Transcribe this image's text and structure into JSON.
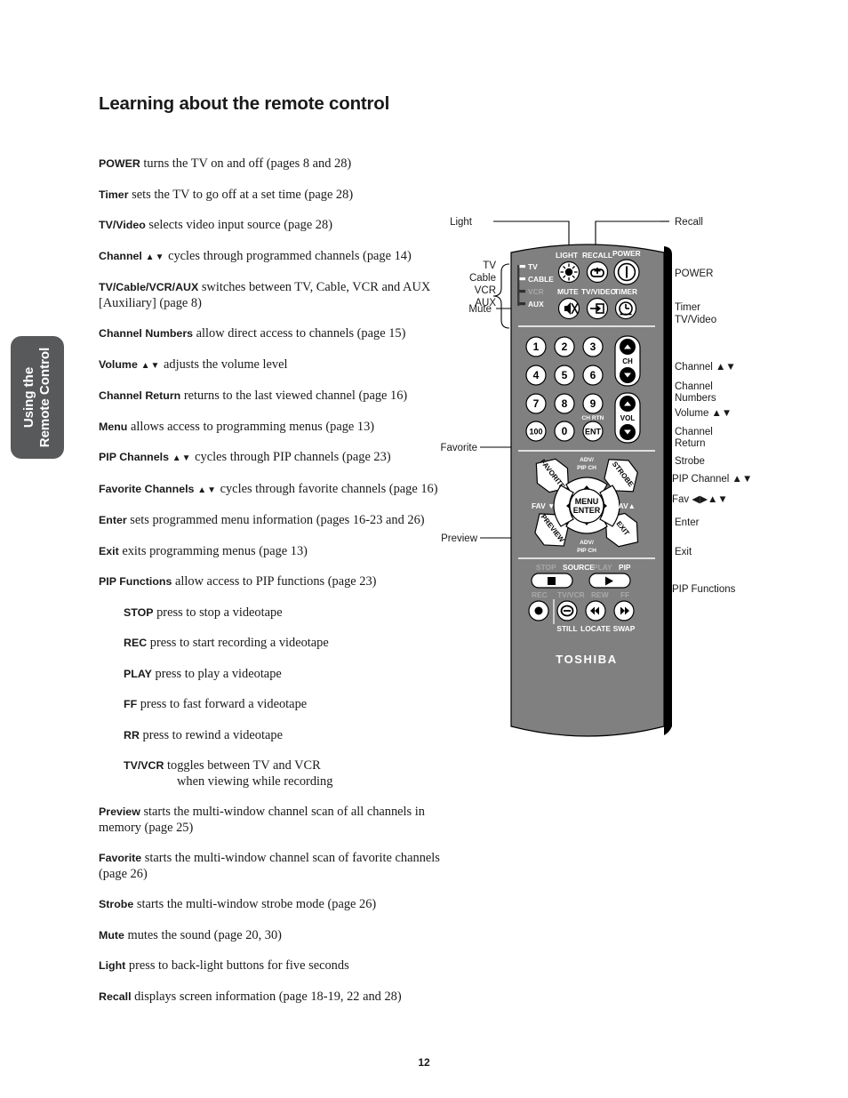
{
  "page": {
    "title": "Learning about the remote control",
    "number": "12",
    "side_tab": "Using the\nRemote Control",
    "brand": "TOSHIBA"
  },
  "descriptions": [
    {
      "term": "POWER",
      "arrows": "",
      "text": " turns the TV on and off (pages 8 and 28)",
      "indent": false
    },
    {
      "term": "Timer",
      "arrows": "",
      "text": " sets the TV to go off at a set time (page 28)",
      "indent": false
    },
    {
      "term": "TV/Video",
      "arrows": "",
      "text": "  selects video input source (page 28)",
      "indent": false
    },
    {
      "term": "Channel",
      "arrows": " ▲▼",
      "text": " cycles through programmed channels (page 14)",
      "indent": false
    },
    {
      "term": "TV/Cable/VCR/AUX",
      "arrows": "",
      "text": " switches between TV, Cable, VCR and AUX [Auxiliary] (page 8)",
      "indent": false
    },
    {
      "term": "Channel Numbers",
      "arrows": "",
      "text": " allow direct access to channels (page 15)",
      "indent": false
    },
    {
      "term": "Volume",
      "arrows": " ▲▼",
      "text": " adjusts the volume level",
      "indent": false
    },
    {
      "term": "Channel Return",
      "arrows": "",
      "text": " returns to the last viewed channel (page 16)",
      "indent": false
    },
    {
      "term": "Menu",
      "arrows": "",
      "text": " allows access to programming menus (page 13)",
      "indent": false
    },
    {
      "term": "PIP Channels",
      "arrows": " ▲▼",
      "text": " cycles through PIP channels (page 23)",
      "indent": false
    },
    {
      "term": "Favorite Channels",
      "arrows": " ▲▼",
      "text": " cycles through favorite channels (page 16)",
      "indent": false
    },
    {
      "term": "Enter",
      "arrows": "",
      "text": " sets programmed menu information (pages 16-23 and 26)",
      "indent": false
    },
    {
      "term": "Exit",
      "arrows": "",
      "text": " exits programming menus (page 13)",
      "indent": false
    },
    {
      "term": "PIP Functions",
      "arrows": "",
      "text": " allow access to PIP functions (page 23)",
      "indent": false
    },
    {
      "term": "STOP",
      "arrows": "",
      "text": " press to stop a videotape",
      "indent": true
    },
    {
      "term": "REC",
      "arrows": "",
      "text": " press to start recording a videotape",
      "indent": true
    },
    {
      "term": "PLAY",
      "arrows": "",
      "text": " press to play a videotape",
      "indent": true
    },
    {
      "term": "FF",
      "arrows": "",
      "text": " press to fast forward a videotape",
      "indent": true
    },
    {
      "term": "RR",
      "arrows": "",
      "text": " press to rewind a videotape",
      "indent": true
    },
    {
      "term": "TV/VCR",
      "arrows": "",
      "text": "  toggles between TV and VCR",
      "text2": "when viewing while recording",
      "indent": true
    },
    {
      "term": "Preview",
      "arrows": "",
      "text": " starts the multi-window channel scan of all channels in memory (page 25)",
      "indent": false
    },
    {
      "term": "Favorite",
      "arrows": "",
      "text": " starts the multi-window channel scan of favorite channels (page 26)",
      "indent": false
    },
    {
      "term": "Strobe",
      "arrows": "",
      "text": " starts the multi-window strobe mode (page 26)",
      "indent": false
    },
    {
      "term": "Mute",
      "arrows": "",
      "text": " mutes the sound (page 20, 30)",
      "indent": false
    },
    {
      "term": "Light",
      "arrows": "",
      "text": " press to back-light buttons for five seconds",
      "indent": false
    },
    {
      "term": "Recall",
      "arrows": "",
      "text": " displays screen information (page 18-19, 22 and 28)",
      "indent": false
    }
  ],
  "callouts": {
    "left": [
      {
        "id": "light",
        "label": "Light"
      },
      {
        "id": "tv",
        "label": "TV"
      },
      {
        "id": "cable",
        "label": "Cable"
      },
      {
        "id": "vcr",
        "label": "VCR"
      },
      {
        "id": "aux",
        "label": "AUX"
      },
      {
        "id": "mute",
        "label": "Mute"
      },
      {
        "id": "favorite",
        "label": "Favorite"
      },
      {
        "id": "preview",
        "label": "Preview"
      }
    ],
    "right": [
      {
        "id": "recall",
        "label": "Recall"
      },
      {
        "id": "power",
        "label": "POWER"
      },
      {
        "id": "timer",
        "label": "Timer"
      },
      {
        "id": "tvvideo",
        "label": "TV/Video"
      },
      {
        "id": "channel",
        "label": "Channel ▲▼"
      },
      {
        "id": "channel-numbers-1",
        "label": "Channel"
      },
      {
        "id": "channel-numbers-2",
        "label": "Numbers"
      },
      {
        "id": "volume",
        "label": "Volume ▲▼"
      },
      {
        "id": "channel-return-1",
        "label": "Channel"
      },
      {
        "id": "channel-return-2",
        "label": "Return"
      },
      {
        "id": "strobe",
        "label": "Strobe"
      },
      {
        "id": "pip-channel",
        "label": "PIP Channel ▲▼"
      },
      {
        "id": "fav",
        "label": "Fav ◀▶▲▼"
      },
      {
        "id": "enter",
        "label": "Enter"
      },
      {
        "id": "exit",
        "label": "Exit"
      },
      {
        "id": "pip-functions",
        "label": "PIP Functions"
      }
    ]
  },
  "remote": {
    "selector": {
      "options": [
        "TV",
        "CABLE",
        "VCR",
        "AUX"
      ],
      "selected": "TV"
    },
    "top_row_labels": [
      "LIGHT",
      "RECALL",
      "POWER"
    ],
    "second_row_labels": [
      "MUTE",
      "TV/VIDEO",
      "TIMER"
    ],
    "keypad": [
      "1",
      "2",
      "3",
      "4",
      "5",
      "6",
      "7",
      "8",
      "9",
      "100",
      "0",
      "ENT"
    ],
    "keypad_sublabel": "CH RTN",
    "rocker_ch": "CH",
    "rocker_vol": "VOL",
    "side_buttons": {
      "favorite": "FAVORITE",
      "strobe": "STROBE",
      "preview": "PREVIEW",
      "exit": "EXIT"
    },
    "dpad": {
      "center_line1": "MENU",
      "center_line2": "ENTER",
      "top_label1": "ADV/",
      "top_label2": "PIP CH",
      "bottom_label1": "ADV/",
      "bottom_label2": "PIP CH",
      "left_label": "FAV ▼",
      "right_label": "FAV▲"
    },
    "vcr_row1_labels": [
      "STOP",
      "SOURCE",
      "PLAY",
      "PIP"
    ],
    "vcr_row2_labels": [
      "REC",
      "TV/VCR",
      "REW",
      "FF"
    ],
    "vcr_row3_labels": [
      "STILL",
      "LOCATE",
      "SWAP"
    ]
  },
  "colors": {
    "body": "#808080",
    "shadow": "#000000",
    "button": "#ffffff",
    "text": "#1a1a1a",
    "tab": "#58595b"
  }
}
